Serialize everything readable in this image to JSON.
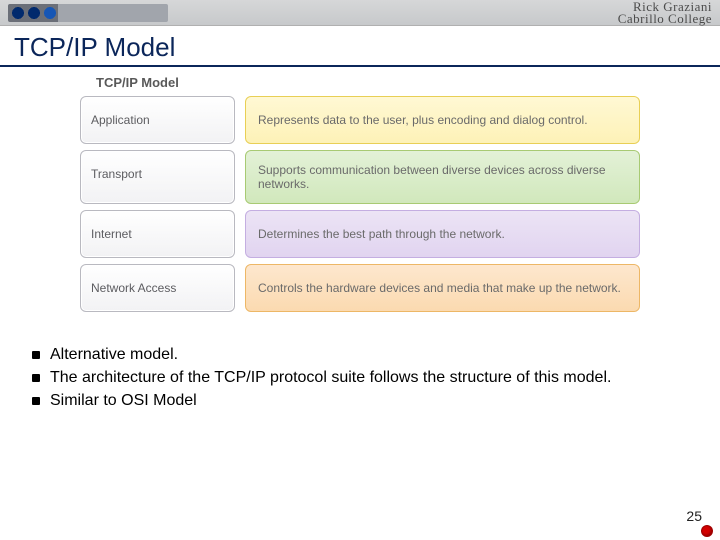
{
  "header": {
    "author": "Rick Graziani",
    "org": "Cabrillo College"
  },
  "title": "TCP/IP Model",
  "diagram": {
    "title": "TCP/IP Model",
    "layers": [
      {
        "name": "Application",
        "desc": "Represents data to the user, plus encoding and dialog control.",
        "class": "yellow"
      },
      {
        "name": "Transport",
        "desc": "Supports communication between diverse devices across diverse networks.",
        "class": "green"
      },
      {
        "name": "Internet",
        "desc": "Determines the best path through the network.",
        "class": "purple"
      },
      {
        "name": "Network Access",
        "desc": "Controls the hardware devices and media that make up the network.",
        "class": "orange"
      }
    ]
  },
  "bullets": [
    "Alternative model.",
    "The architecture of the TCP/IP protocol suite follows the structure of this model.",
    "Similar to OSI Model"
  ],
  "slide_number": "25"
}
